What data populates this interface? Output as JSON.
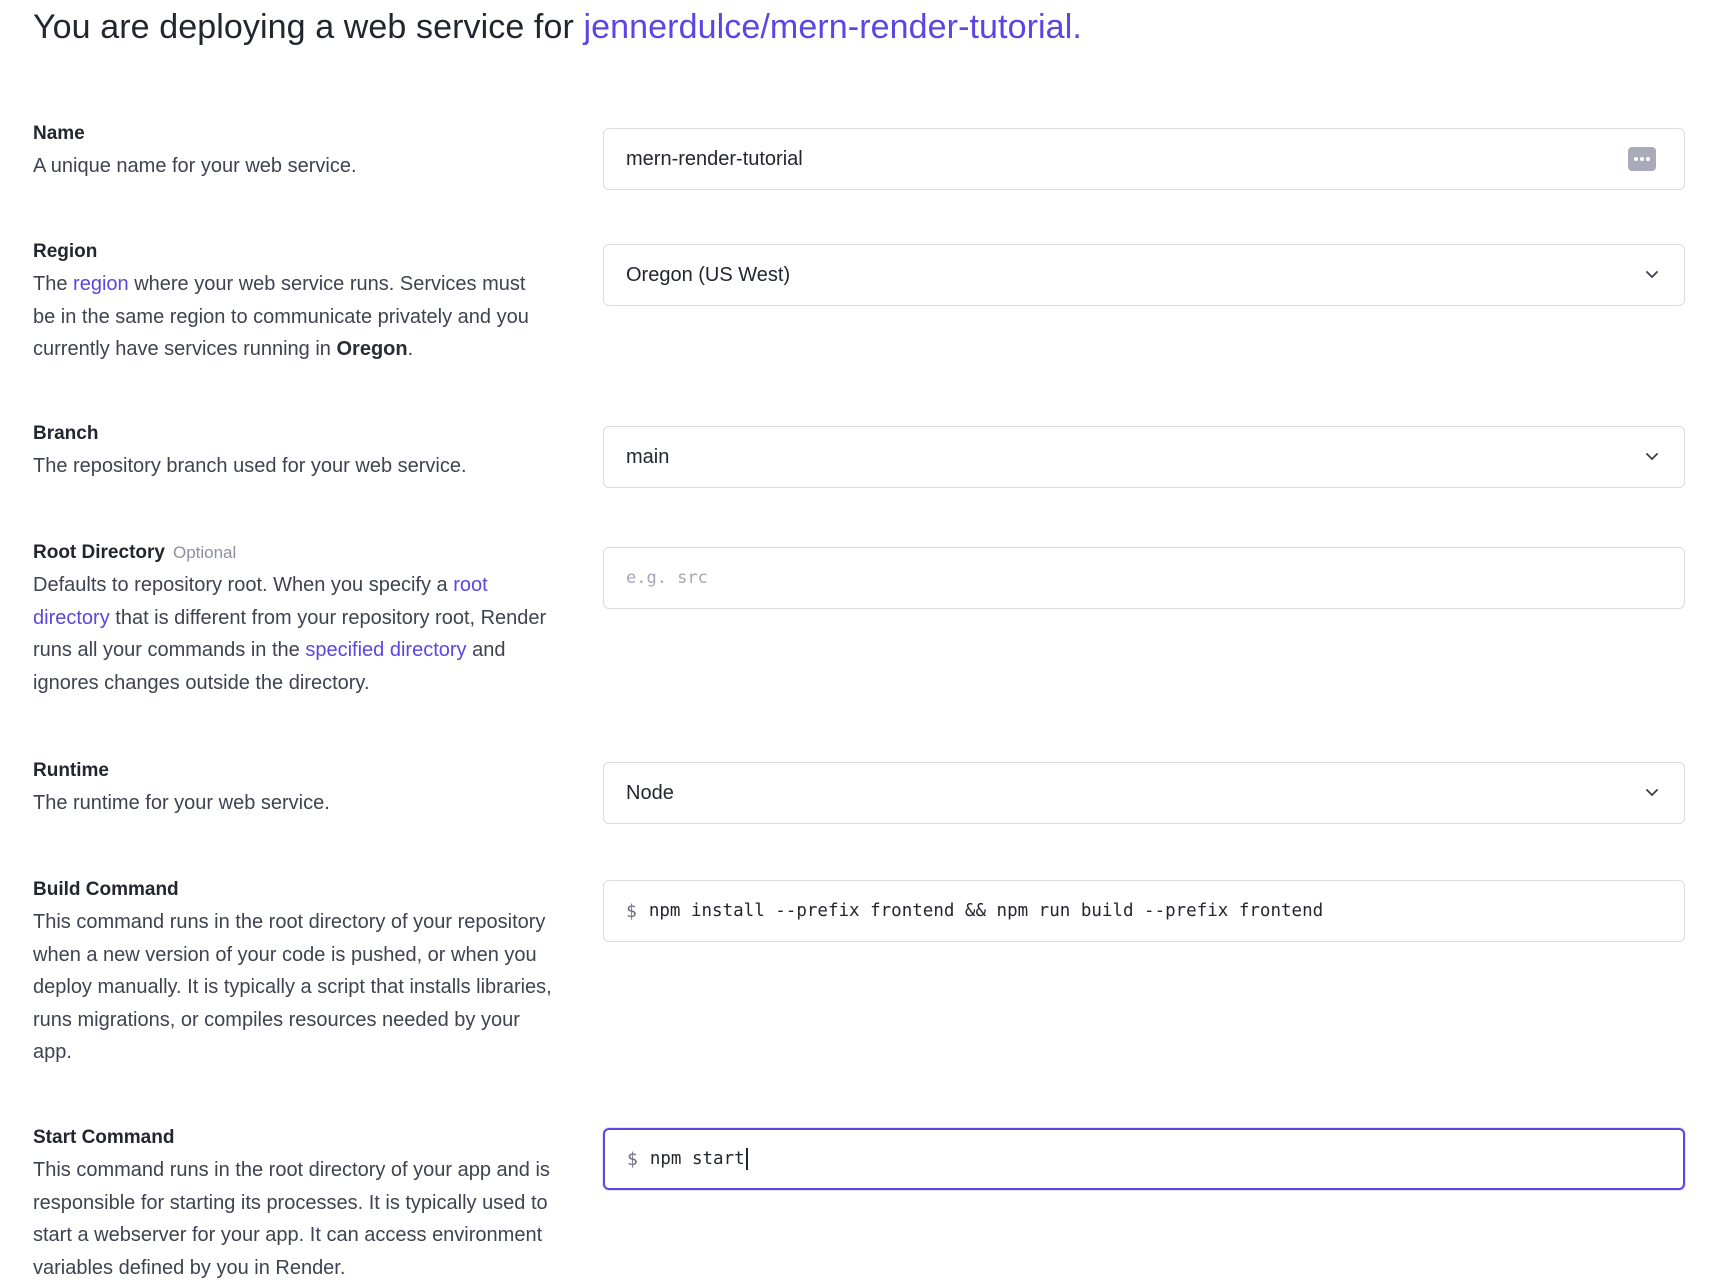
{
  "header": {
    "title_prefix": "You are deploying a web service for",
    "repo": "jennerdulce/mern-render-tutorial."
  },
  "fields": {
    "name": {
      "label": "Name",
      "description": "A unique name for your web service.",
      "value": "mern-render-tutorial",
      "icon": "password-manager-icon"
    },
    "region": {
      "label": "Region",
      "desc_1": "The",
      "desc_link": "region",
      "desc_2": "where your web service runs. Services must be in the same region to communicate privately and you currently have services running in",
      "desc_bold": "Oregon",
      "desc_3": ".",
      "value": "Oregon (US West)"
    },
    "branch": {
      "label": "Branch",
      "description": "The repository branch used for your web service.",
      "value": "main"
    },
    "root_directory": {
      "label": "Root Directory",
      "optional": "Optional",
      "desc_1": "Defaults to repository root. When you specify a",
      "desc_link_1": "root directory",
      "desc_2": "that is different from your repository root, Render runs all your commands in the",
      "desc_link_2": "specified directory",
      "desc_3": "and ignores changes outside the directory.",
      "placeholder": "e.g. src",
      "value": ""
    },
    "runtime": {
      "label": "Runtime",
      "description": "The runtime for your web service.",
      "value": "Node"
    },
    "build_command": {
      "label": "Build Command",
      "description": "This command runs in the root directory of your repository when a new version of your code is pushed, or when you deploy manually. It is typically a script that installs libraries, runs migrations, or compiles resources needed by your app.",
      "prompt": "$",
      "value": "npm install --prefix frontend && npm run build --prefix frontend"
    },
    "start_command": {
      "label": "Start Command",
      "description": "This command runs in the root directory of your app and is responsible for starting its processes. It is typically used to start a webserver for your app. It can access environment variables defined by you in Render.",
      "prompt": "$",
      "value": "npm start"
    }
  },
  "colors": {
    "accent": "#5a46e3",
    "text": "#23252f",
    "muted_text": "#3f4250",
    "border": "#d9dbe2"
  }
}
